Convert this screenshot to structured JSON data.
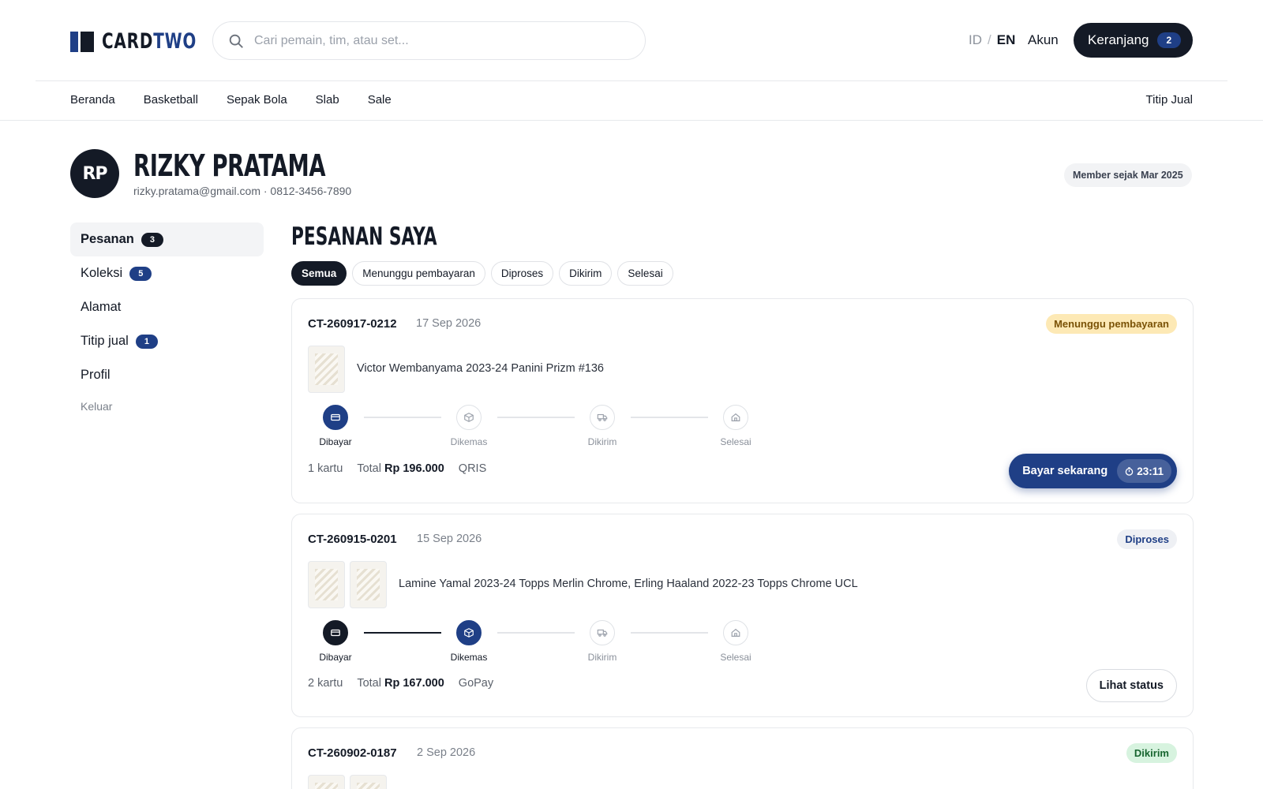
{
  "header": {
    "logo": {
      "part1": "CARD",
      "part2": "TWO"
    },
    "search_placeholder": "Cari pemain, tim, atau set...",
    "lang": {
      "id": "ID",
      "sep": "/",
      "en": "EN"
    },
    "account_label": "Akun",
    "cart": {
      "label": "Keranjang",
      "count": "2"
    }
  },
  "nav": {
    "items": [
      "Beranda",
      "Basketball",
      "Sepak Bola",
      "Slab",
      "Sale"
    ],
    "right": "Titip Jual"
  },
  "profile": {
    "initials": "RP",
    "name": "RIZKY PRATAMA",
    "contact": "rizky.pratama@gmail.com  · 0812-3456-7890",
    "member_since": "Member sejak Mar 2025"
  },
  "sidebar": {
    "items": [
      {
        "label": "Pesanan",
        "badge": "3"
      },
      {
        "label": "Koleksi",
        "badge": "5"
      },
      {
        "label": "Alamat"
      },
      {
        "label": "Titip jual",
        "badge": "1"
      },
      {
        "label": "Profil"
      }
    ],
    "logout": "Keluar"
  },
  "main": {
    "title": "PESANAN SAYA",
    "filters": [
      "Semua",
      "Menunggu pembayaran",
      "Diproses",
      "Dikirim",
      "Selesai"
    ],
    "step_labels": [
      "Dibayar",
      "Dikemas",
      "Dikirim",
      "Selesai"
    ],
    "orders": [
      {
        "id": "CT-260917-0212",
        "date": "17 Sep 2026",
        "status": "Menunggu pembayaran",
        "items": "Victor Wembanyama 2023-24 Panini Prizm #136",
        "count": "1 kartu",
        "total_label": "Total",
        "total": "Rp 196.000",
        "method": "QRIS",
        "action": "Bayar sekarang",
        "timer": "23:11"
      },
      {
        "id": "CT-260915-0201",
        "date": "15 Sep 2026",
        "status": "Diproses",
        "items": "Lamine Yamal 2023-24 Topps Merlin Chrome, Erling Haaland 2022-23 Topps Chrome UCL",
        "count": "2 kartu",
        "total_label": "Total",
        "total": "Rp 167.000",
        "method": "GoPay",
        "action": "Lihat status"
      },
      {
        "id": "CT-260902-0187",
        "date": "2 Sep 2026",
        "status": "Dikirim"
      }
    ]
  },
  "icons": {
    "search": "search-icon",
    "pay": "card-icon",
    "pack": "box-icon",
    "ship": "truck-icon",
    "done": "house-icon",
    "timer": "clock-icon"
  },
  "colors": {
    "navy": "#1f3f86",
    "ink": "#141a26",
    "wait": "#fde9b5",
    "ship": "#d7f3df"
  }
}
